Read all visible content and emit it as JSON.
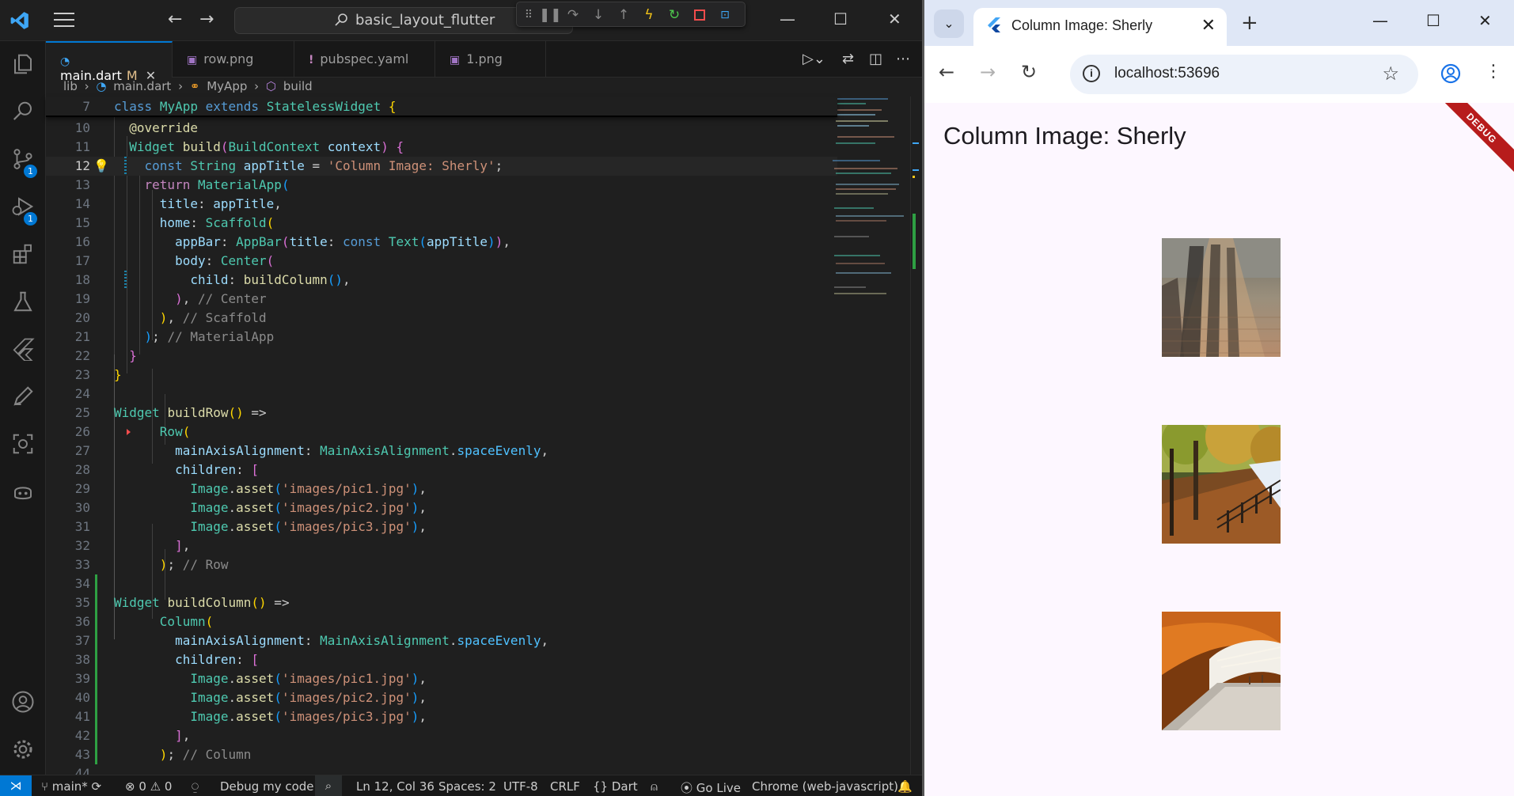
{
  "vscode": {
    "search_text": "basic_layout_flutter",
    "tabs": [
      {
        "label": "main.dart",
        "modified": "M"
      },
      {
        "label": "row.png"
      },
      {
        "label": "pubspec.yaml"
      },
      {
        "label": "1.png"
      }
    ],
    "breadcrumb": [
      "lib",
      "main.dart",
      "MyApp",
      "build"
    ],
    "activity_badges": {
      "source_control": "1",
      "run_debug": "1"
    },
    "statusbar": {
      "branch": "main*",
      "errors": "0",
      "warnings": "0",
      "debug_target": "Debug my code",
      "cursor": "Ln 12, Col 36",
      "spaces": "Spaces: 2",
      "encoding": "UTF-8",
      "eol": "CRLF",
      "language": "Dart",
      "golive": "Go Live",
      "device": "Chrome (web-javascript)"
    },
    "current_line": "12"
  },
  "chrome": {
    "tab_title": "Column Image: Sherly",
    "url": "localhost:53696",
    "app_title": "Column Image: Sherly",
    "debug_banner": "DEBUG",
    "images": [
      "images/pic1.jpg",
      "images/pic2.jpg",
      "images/pic3.jpg"
    ]
  }
}
